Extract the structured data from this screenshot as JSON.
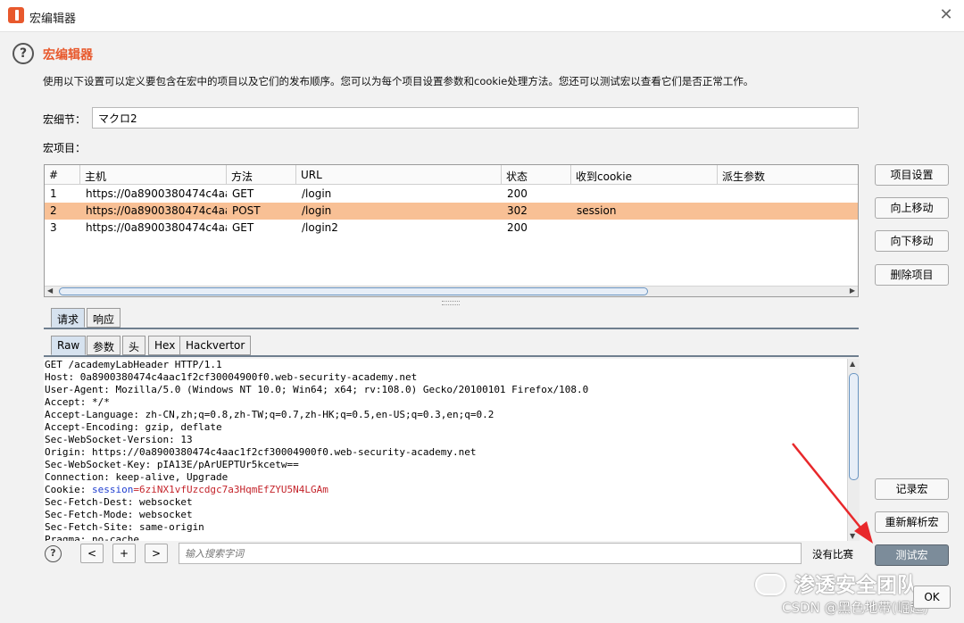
{
  "window": {
    "title": "宏编辑器",
    "close_glyph": "✕"
  },
  "dialog": {
    "title": "宏编辑器",
    "help_glyph": "?",
    "description": "使用以下设置可以定义要包含在宏中的项目以及它们的发布顺序。您可以为每个项目设置参数和cookie处理方法。您还可以测试宏以查看它们是否正常工作。"
  },
  "macro": {
    "name_label": "宏细节：",
    "name_value": "マクロ2",
    "items_label": "宏项目："
  },
  "table": {
    "columns": [
      "#",
      "主机",
      "方法",
      "URL",
      "状态",
      "收到cookie",
      "派生参数"
    ],
    "rows": [
      {
        "num": "1",
        "host": "https://0a8900380474c4aa...",
        "method": "GET",
        "url": "/login",
        "status": "200",
        "cookie": "",
        "derived": ""
      },
      {
        "num": "2",
        "host": "https://0a8900380474c4aa...",
        "method": "POST",
        "url": "/login",
        "status": "302",
        "cookie": "session",
        "derived": ""
      },
      {
        "num": "3",
        "host": "https://0a8900380474c4aa...",
        "method": "GET",
        "url": "/login2",
        "status": "200",
        "cookie": "",
        "derived": ""
      }
    ],
    "selected_row": 2
  },
  "side_buttons": {
    "item_settings": "项目设置",
    "move_up": "向上移动",
    "move_down": "向下移动",
    "delete_item": "删除项目",
    "record_macro": "记录宏",
    "reanalyze_macro": "重新解析宏",
    "test_macro": "测试宏"
  },
  "tabs_main": [
    "请求",
    "响应"
  ],
  "tabs_sub": [
    "Raw",
    "参数",
    "头",
    "Hex",
    "Hackvertor"
  ],
  "request": {
    "lines": [
      "GET /academyLabHeader HTTP/1.1",
      "Host: 0a8900380474c4aac1f2cf30004900f0.web-security-academy.net",
      "User-Agent: Mozilla/5.0 (Windows NT 10.0; Win64; x64; rv:108.0) Gecko/20100101 Firefox/108.0",
      "Accept: */*",
      "Accept-Language: zh-CN,zh;q=0.8,zh-TW;q=0.7,zh-HK;q=0.5,en-US;q=0.3,en;q=0.2",
      "Accept-Encoding: gzip, deflate",
      "Sec-WebSocket-Version: 13",
      "Origin: https://0a8900380474c4aac1f2cf30004900f0.web-security-academy.net",
      "Sec-WebSocket-Key: pIA13E/pArUEPTUr5kcetw==",
      "Connection: keep-alive, Upgrade"
    ],
    "cookie_prefix": "Cookie: ",
    "cookie_name": "session",
    "cookie_value": "=6ziNX1vfUzcdgc7a3HqmEfZYU5N4LGAm",
    "lines_after": [
      "Sec-Fetch-Dest: websocket",
      "Sec-Fetch-Mode: websocket",
      "Sec-Fetch-Site: same-origin",
      "Pragma: no-cache"
    ]
  },
  "search": {
    "help_glyph": "?",
    "prev": "<",
    "add": "+",
    "next": ">",
    "placeholder": "输入搜索字词",
    "matches": "没有比赛"
  },
  "ok_button": "OK",
  "watermark": {
    "text": "渗透安全团队",
    "csdn": "CSDN @黑色地带(崛起)"
  },
  "colors": {
    "accent": "#e8592d",
    "selected_row": "#f8c095",
    "annotation_arrow": "#e8282b",
    "cookie_name": "#1f3ed0",
    "cookie_value": "#c4242b"
  }
}
